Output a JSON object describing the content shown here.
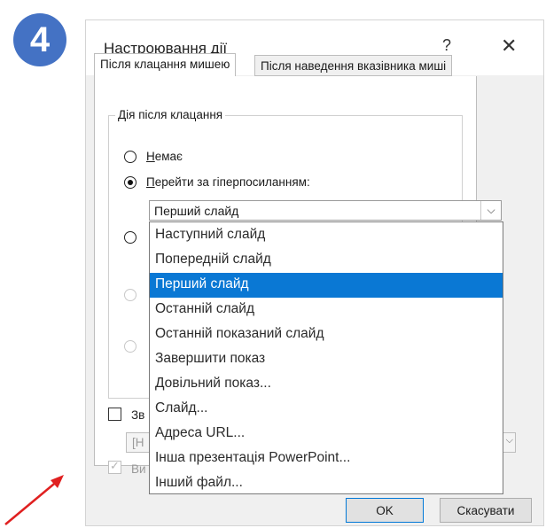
{
  "badge": {
    "number": "4"
  },
  "dialog": {
    "title": "Настроювання дії",
    "help_label": "?",
    "close_label": "✕",
    "tabs": [
      {
        "label": "Після клацання мишею",
        "active": true
      },
      {
        "label": "Після наведення вказівника миші",
        "active": false
      }
    ],
    "group_legend": "Дія після клацання",
    "radios": {
      "none_label": "Немає",
      "none_underline_char": "Н",
      "none_rest": "емає",
      "hyperlink_label": "Перейти за гіперпосиланням:",
      "hyperlink_underline_char": "П",
      "hyperlink_rest": "ерейти за гіперпосиланням:"
    },
    "combo": {
      "selected_value": "Перший слайд",
      "arrow": "⌵"
    },
    "dropdown_options": [
      "Наступний слайд",
      "Попередній слайд",
      "Перший слайд",
      "Останній слайд",
      "Останній показаний слайд",
      "Завершити показ",
      "Довільний показ...",
      "Слайд...",
      "Адреса URL...",
      "Інша презентація PowerPoint...",
      "Інший файл..."
    ],
    "selected_option_index": 2,
    "sound_partial_label": "Зв",
    "sound_partial_value": "[Н",
    "highlight_partial_label": "Ви",
    "ok_label": "OK",
    "cancel_label": "Скасувати"
  },
  "colors": {
    "badge": "#4472c4",
    "selection": "#0a78d4",
    "arrow": "#e02020"
  }
}
